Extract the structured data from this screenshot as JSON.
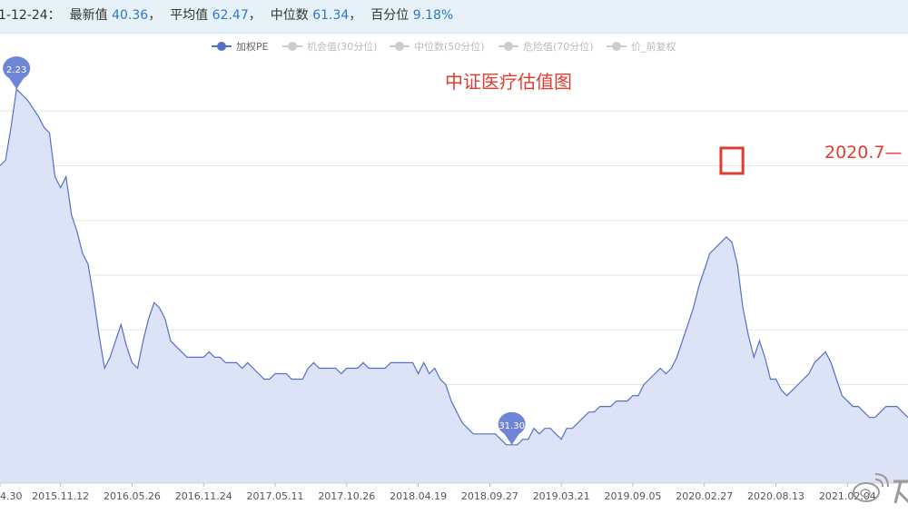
{
  "header": {
    "date": "1-12-24：",
    "latest_label": "最新值",
    "latest_value": "40.36",
    "mean_label": "平均值",
    "mean_value": "62.47",
    "median_label": "中位数",
    "median_value": "61.34",
    "pct_label": "百分位",
    "pct_value": "9.18%",
    "sep": "，"
  },
  "legend": [
    {
      "name": "加权PE",
      "color": "#5470c6",
      "active": true
    },
    {
      "name": "机会值(30分位)",
      "color": "#cccccc",
      "active": false
    },
    {
      "name": "中位数(50分位)",
      "color": "#cccccc",
      "active": false
    },
    {
      "name": "危险值(70分位)",
      "color": "#cccccc",
      "active": false
    },
    {
      "name": "价_前复权",
      "color": "#cccccc",
      "active": false
    }
  ],
  "annotations": {
    "chart_title": "中证医疗估值图",
    "note": "2020.7—",
    "max_pin": "2.23",
    "min_pin": "31.30",
    "accent": "#e03c31"
  },
  "chart_data": {
    "type": "area",
    "title": "中证医疗估值图",
    "series": [
      {
        "name": "加权PE",
        "color": "#5470c6",
        "fill": "#dde3f7",
        "points": [
          [
            0,
            86
          ],
          [
            1,
            87
          ],
          [
            2,
            93
          ],
          [
            3,
            100
          ],
          [
            5,
            98
          ],
          [
            7,
            95
          ],
          [
            8,
            93
          ],
          [
            9,
            92
          ],
          [
            10,
            84
          ],
          [
            11,
            82
          ],
          [
            12,
            84
          ],
          [
            13,
            77
          ],
          [
            14,
            74
          ],
          [
            15,
            70
          ],
          [
            16,
            68
          ],
          [
            17,
            62
          ],
          [
            18,
            55
          ],
          [
            19,
            49
          ],
          [
            20,
            51
          ],
          [
            21,
            54
          ],
          [
            22,
            57
          ],
          [
            23,
            53
          ],
          [
            24,
            50
          ],
          [
            25,
            49
          ],
          [
            26,
            54
          ],
          [
            27,
            58
          ],
          [
            28,
            61
          ],
          [
            29,
            60
          ],
          [
            30,
            58
          ],
          [
            31,
            54
          ],
          [
            32,
            53
          ],
          [
            33,
            52
          ],
          [
            34,
            51
          ],
          [
            35,
            51
          ],
          [
            36,
            51
          ],
          [
            37,
            51
          ],
          [
            38,
            52
          ],
          [
            39,
            51
          ],
          [
            40,
            51
          ],
          [
            41,
            50
          ],
          [
            42,
            50
          ],
          [
            43,
            50
          ],
          [
            44,
            49
          ],
          [
            45,
            50
          ],
          [
            46,
            49
          ],
          [
            47,
            48
          ],
          [
            48,
            47
          ],
          [
            49,
            47
          ],
          [
            50,
            48
          ],
          [
            51,
            48
          ],
          [
            52,
            48
          ],
          [
            53,
            47
          ],
          [
            54,
            47
          ],
          [
            55,
            47
          ],
          [
            56,
            49
          ],
          [
            57,
            50
          ],
          [
            58,
            49
          ],
          [
            59,
            49
          ],
          [
            60,
            49
          ],
          [
            61,
            49
          ],
          [
            62,
            48
          ],
          [
            63,
            49
          ],
          [
            64,
            49
          ],
          [
            65,
            49
          ],
          [
            66,
            50
          ],
          [
            67,
            49
          ],
          [
            68,
            49
          ],
          [
            69,
            49
          ],
          [
            70,
            49
          ],
          [
            71,
            50
          ],
          [
            72,
            50
          ],
          [
            73,
            50
          ],
          [
            74,
            50
          ],
          [
            75,
            50
          ],
          [
            76,
            48
          ],
          [
            77,
            50
          ],
          [
            78,
            48
          ],
          [
            79,
            49
          ],
          [
            80,
            47
          ],
          [
            81,
            46
          ],
          [
            82,
            43
          ],
          [
            83,
            41
          ],
          [
            84,
            39
          ],
          [
            85,
            38
          ],
          [
            86,
            37
          ],
          [
            87,
            37
          ],
          [
            88,
            37
          ],
          [
            89,
            37
          ],
          [
            90,
            37
          ],
          [
            91,
            36
          ],
          [
            92,
            35
          ],
          [
            93,
            35
          ],
          [
            94,
            35
          ],
          [
            95,
            36
          ],
          [
            96,
            36
          ],
          [
            97,
            38
          ],
          [
            98,
            37
          ],
          [
            99,
            38
          ],
          [
            100,
            38
          ],
          [
            101,
            37
          ],
          [
            102,
            36
          ],
          [
            103,
            38
          ],
          [
            104,
            38
          ],
          [
            105,
            39
          ],
          [
            106,
            40
          ],
          [
            107,
            41
          ],
          [
            108,
            41
          ],
          [
            109,
            42
          ],
          [
            110,
            42
          ],
          [
            111,
            42
          ],
          [
            112,
            43
          ],
          [
            113,
            43
          ],
          [
            114,
            43
          ],
          [
            115,
            44
          ],
          [
            116,
            44
          ],
          [
            117,
            46
          ],
          [
            118,
            47
          ],
          [
            119,
            48
          ],
          [
            120,
            49
          ],
          [
            121,
            48
          ],
          [
            122,
            49
          ],
          [
            123,
            51
          ],
          [
            124,
            54
          ],
          [
            125,
            57
          ],
          [
            126,
            60
          ],
          [
            127,
            64
          ],
          [
            128,
            67
          ],
          [
            129,
            70
          ],
          [
            130,
            71
          ],
          [
            131,
            72
          ],
          [
            132,
            73
          ],
          [
            133,
            72
          ],
          [
            134,
            68
          ],
          [
            135,
            60
          ],
          [
            136,
            55
          ],
          [
            137,
            51
          ],
          [
            138,
            54
          ],
          [
            139,
            51
          ],
          [
            140,
            47
          ],
          [
            141,
            47
          ],
          [
            142,
            45
          ],
          [
            143,
            44
          ],
          [
            144,
            45
          ],
          [
            145,
            46
          ],
          [
            146,
            47
          ],
          [
            147,
            48
          ],
          [
            148,
            50
          ],
          [
            149,
            51
          ],
          [
            150,
            52
          ],
          [
            151,
            50
          ],
          [
            152,
            47
          ],
          [
            153,
            44
          ],
          [
            154,
            43
          ],
          [
            155,
            42
          ],
          [
            156,
            42
          ],
          [
            157,
            41
          ],
          [
            158,
            40
          ],
          [
            159,
            40
          ],
          [
            160,
            41
          ],
          [
            161,
            42
          ],
          [
            162,
            42
          ],
          [
            163,
            42
          ],
          [
            164,
            41
          ],
          [
            165,
            40
          ]
        ]
      }
    ],
    "x_tick_labels": [
      "4.30",
      "2015.11.12",
      "2016.05.26",
      "2016.11.24",
      "2017.05.11",
      "2017.10.26",
      "2018.04.19",
      "2018.09.27",
      "2019.03.21",
      "2019.09.05",
      "2020.02.27",
      "2020.08.13",
      "2021.02.04"
    ],
    "x_tick_index": [
      0,
      11,
      24,
      37,
      50,
      63,
      76,
      89,
      102,
      115,
      128,
      141,
      154
    ],
    "xlim": [
      0,
      165
    ],
    "ylim": [
      28,
      106
    ],
    "y_gridlines": [
      36,
      46,
      56,
      66,
      76,
      86,
      96
    ],
    "grid": true,
    "legend_position": "top-center",
    "max_marker": {
      "index": 3,
      "value": 100
    },
    "min_marker": {
      "index": 93,
      "value": 35
    },
    "highlight_box": {
      "from_index": 131,
      "to_index": 135
    }
  }
}
